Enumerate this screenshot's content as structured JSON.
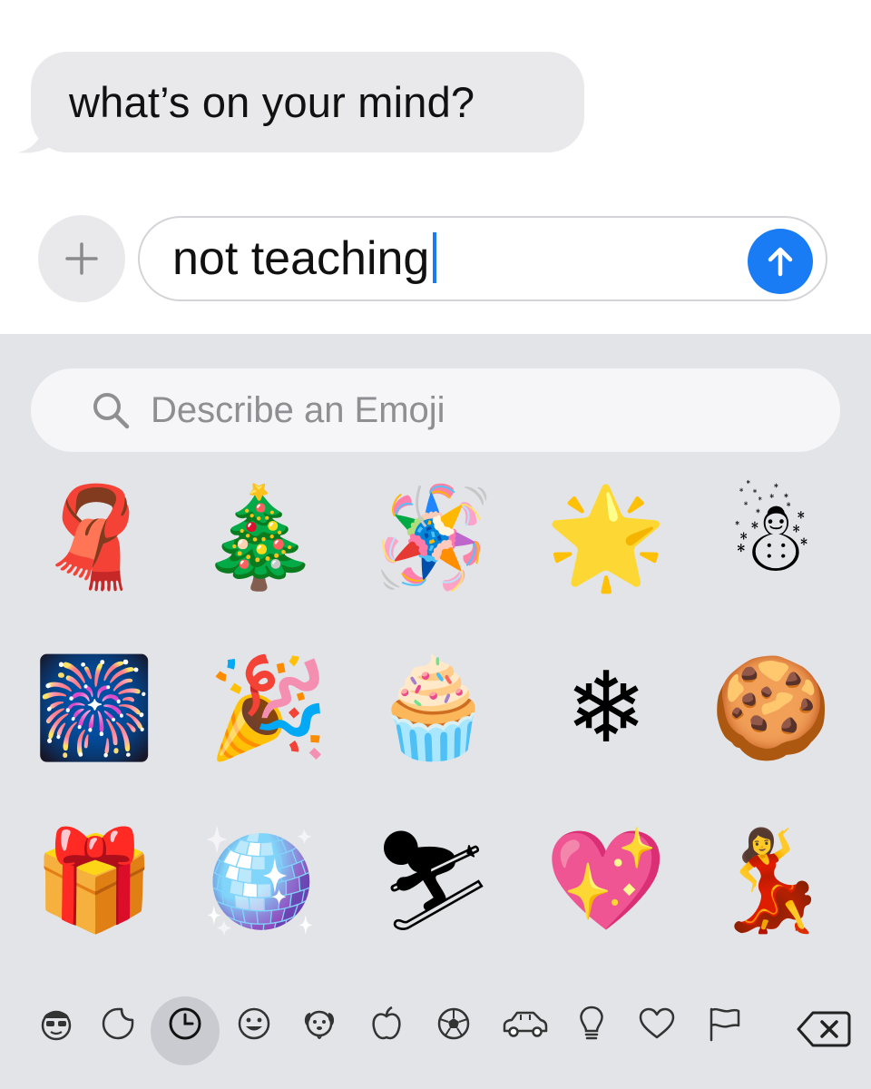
{
  "conversation": {
    "incoming_message": "what’s on your mind?"
  },
  "composer": {
    "text": "not teaching",
    "plus_icon": "plus-icon",
    "send_icon": "arrow-up-icon",
    "accent_color": "#1a7cf5"
  },
  "emoji_keyboard": {
    "search_placeholder": "Describe an Emoji",
    "search_icon": "magnifying-glass-icon",
    "emojis": [
      {
        "name": "scarf",
        "glyph": "🧣"
      },
      {
        "name": "christmas-tree",
        "glyph": "🎄"
      },
      {
        "name": "pinata",
        "glyph": "🪅"
      },
      {
        "name": "glowing-star",
        "glyph": "🌟"
      },
      {
        "name": "snowman",
        "glyph": "☃"
      },
      {
        "name": "fireworks",
        "glyph": "🎆"
      },
      {
        "name": "party-popper",
        "glyph": "🎉"
      },
      {
        "name": "cupcake",
        "glyph": "🧁"
      },
      {
        "name": "snowflake",
        "glyph": "❄"
      },
      {
        "name": "cookie",
        "glyph": "🍪"
      },
      {
        "name": "wrapped-gift",
        "glyph": "🎁"
      },
      {
        "name": "mirror-ball",
        "glyph": "🪩"
      },
      {
        "name": "skier",
        "glyph": "⛷"
      },
      {
        "name": "sparkling-heart",
        "glyph": "💖"
      },
      {
        "name": "woman-dancing",
        "glyph": "💃"
      }
    ],
    "categories": [
      {
        "name": "memoji",
        "icon": "memoji-face-icon"
      },
      {
        "name": "stickers",
        "icon": "sticker-icon"
      },
      {
        "name": "recently-used",
        "icon": "clock-icon",
        "selected": true
      },
      {
        "name": "smileys",
        "icon": "smiley-icon"
      },
      {
        "name": "animals",
        "icon": "dog-icon"
      },
      {
        "name": "food",
        "icon": "apple-icon"
      },
      {
        "name": "activity",
        "icon": "soccer-ball-icon"
      },
      {
        "name": "travel",
        "icon": "car-icon"
      },
      {
        "name": "objects",
        "icon": "lightbulb-icon"
      },
      {
        "name": "symbols",
        "icon": "heart-icon"
      },
      {
        "name": "flags",
        "icon": "flag-icon"
      }
    ],
    "delete_icon": "backspace-icon"
  }
}
